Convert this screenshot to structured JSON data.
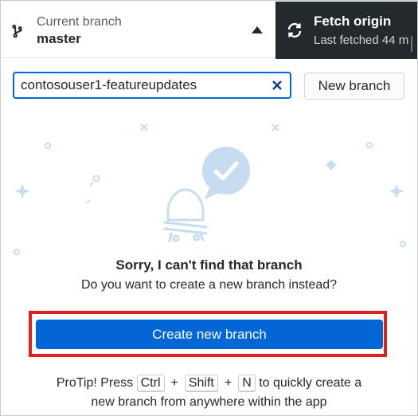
{
  "header": {
    "branch_label": "Current branch",
    "branch_name": "master",
    "fetch_title": "Fetch origin",
    "fetch_subtitle": "Last fetched 44 m"
  },
  "filter": {
    "value": "contosouser1-featureupdates",
    "new_branch_label": "New branch"
  },
  "empty_state": {
    "title": "Sorry, I can't find that branch",
    "subtitle": "Do you want to create a new branch instead?",
    "create_button_label": "Create new branch"
  },
  "protip": {
    "prefix": "ProTip! Press",
    "key_ctrl": "Ctrl",
    "plus1": "+",
    "key_shift": "Shift",
    "plus2": "+",
    "key_n": "N",
    "suffix": "to quickly create a",
    "line2": "new branch from anywhere within the app"
  },
  "colors": {
    "accent": "#0366d6",
    "highlight": "#e02020",
    "dark_header": "#24292e",
    "illustration": "#c7dcf0"
  },
  "icons": {
    "branch": "git-branch-icon",
    "fetch": "sync-icon",
    "clear": "close-icon",
    "caret": "caret-up-icon"
  }
}
